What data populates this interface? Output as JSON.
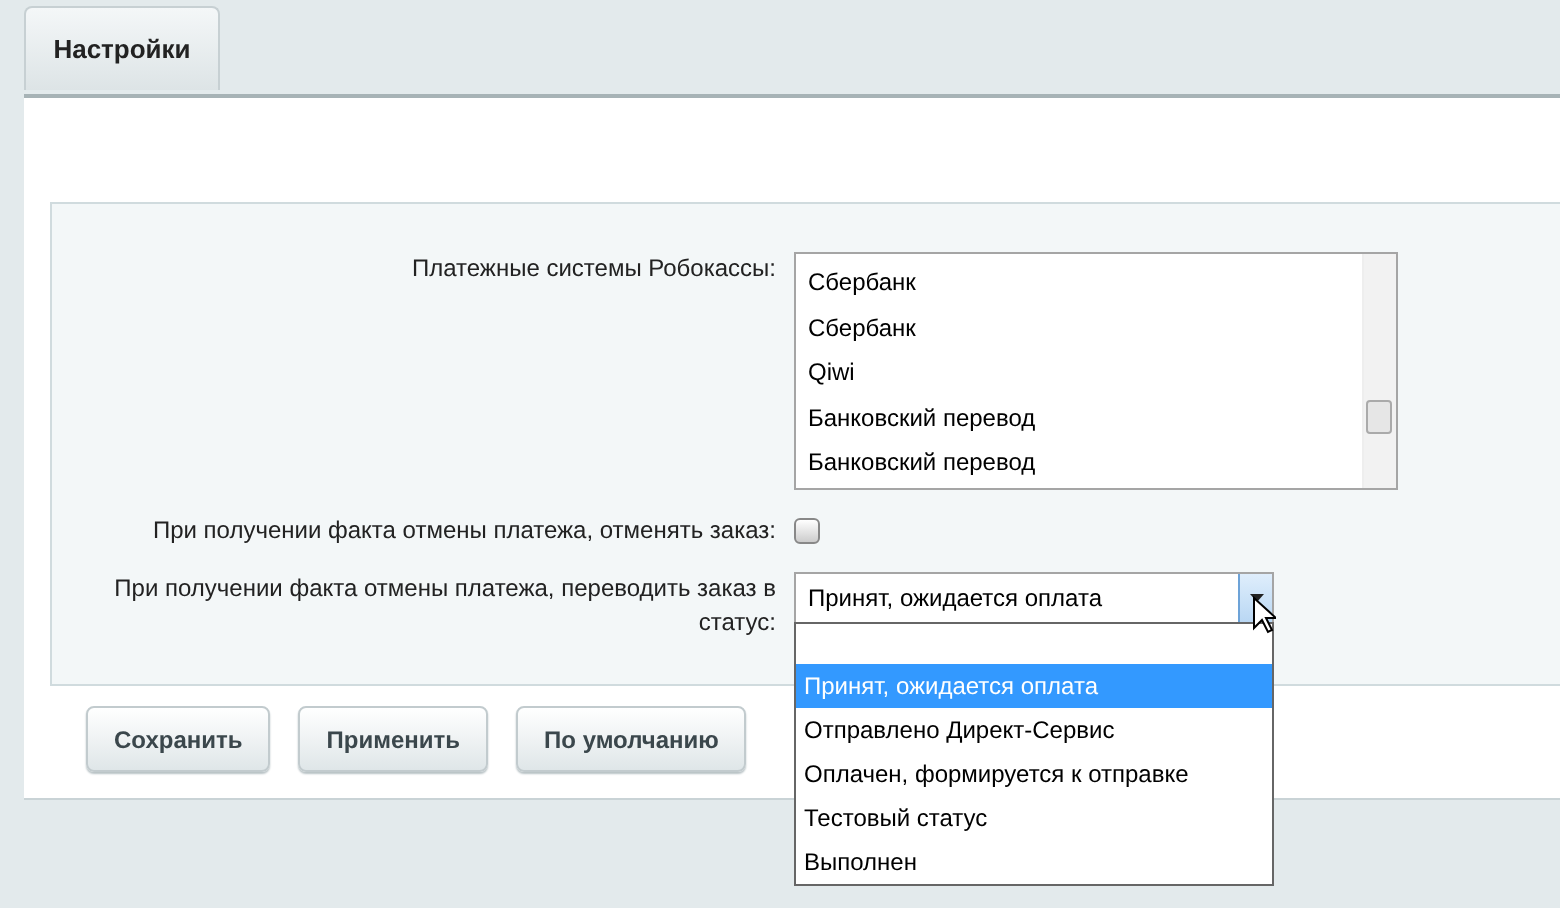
{
  "tabs": [
    {
      "label": "Настройки",
      "selected": true
    }
  ],
  "fields": [
    {
      "kind": "listbox",
      "label": "Платежные системы Робокассы:",
      "options": [
        "Сбербанк",
        "Сбербанк",
        "Qiwi",
        "Банковский перевод",
        "Банковский перевод"
      ]
    },
    {
      "kind": "checkbox",
      "label": "При получении факта отмены платежа, отменять заказ:",
      "checked": false
    },
    {
      "kind": "select",
      "label": "При получении факта отмены платежа, переводить заказ в статус:",
      "value": "Принят, ожидается оплата",
      "expanded": true,
      "options": [
        {
          "label": "Принят, ожидается оплата",
          "selected": true
        },
        {
          "label": "Отправлено Директ-Сервис",
          "selected": false
        },
        {
          "label": "Оплачен, формируется к отправке",
          "selected": false
        },
        {
          "label": "Тестовый статус",
          "selected": false
        },
        {
          "label": "Выполнен",
          "selected": false
        }
      ]
    }
  ],
  "buttons": [
    "Сохранить",
    "Применить",
    "По умолчанию"
  ]
}
